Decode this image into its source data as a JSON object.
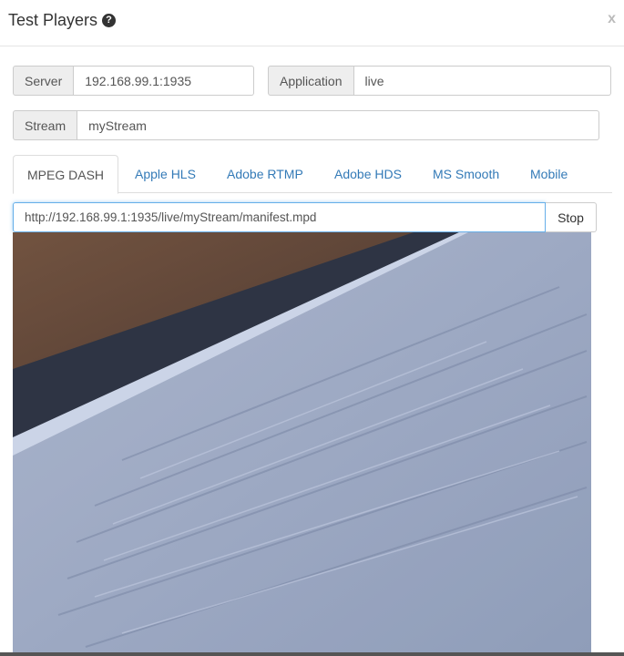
{
  "dialog": {
    "title": "Test Players",
    "close_label": "x"
  },
  "server": {
    "label": "Server",
    "value": "192.168.99.1:1935"
  },
  "application": {
    "label": "Application",
    "value": "live"
  },
  "stream": {
    "label": "Stream",
    "value": "myStream"
  },
  "tabs": [
    {
      "label": "MPEG DASH",
      "active": true
    },
    {
      "label": "Apple HLS",
      "active": false
    },
    {
      "label": "Adobe RTMP",
      "active": false
    },
    {
      "label": "Adobe HDS",
      "active": false
    },
    {
      "label": "MS Smooth",
      "active": false
    },
    {
      "label": "Mobile",
      "active": false
    }
  ],
  "player": {
    "url": "http://192.168.99.1:1935/live/myStream/manifest.mpd",
    "stop_label": "Stop"
  },
  "colors": {
    "link": "#337ab7",
    "focus_border": "#66afe9",
    "addon_bg": "#eeeeee"
  }
}
